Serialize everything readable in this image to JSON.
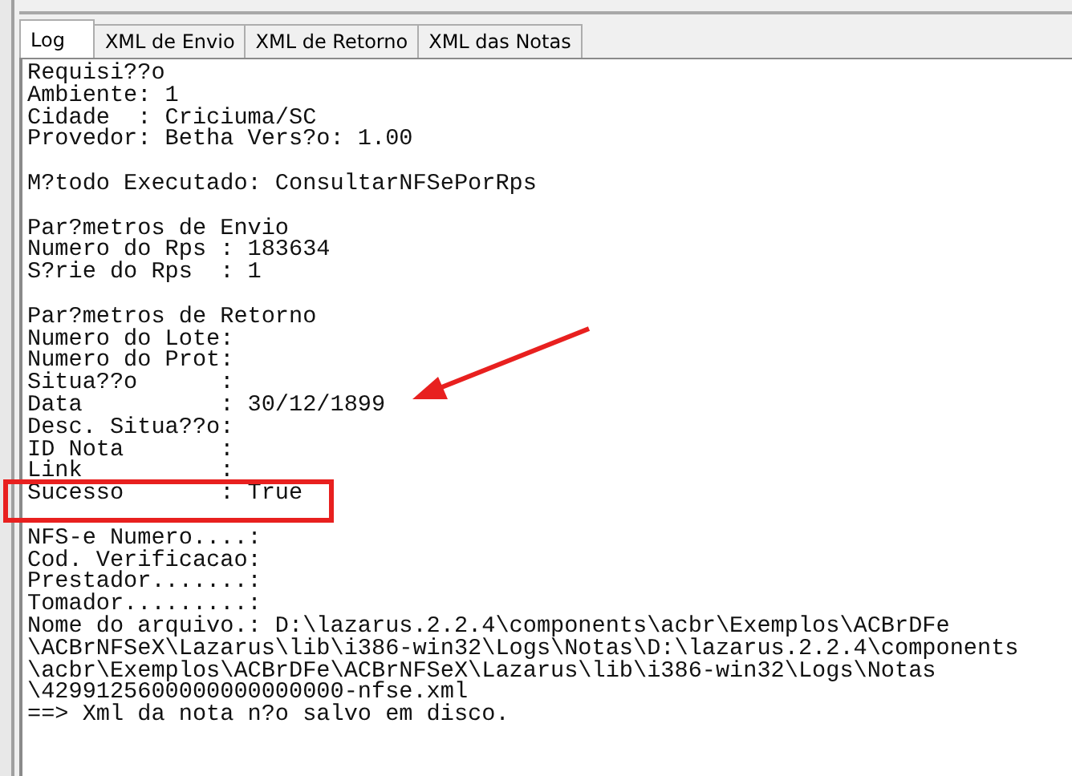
{
  "tabs": [
    {
      "label": "Log",
      "selected": true
    },
    {
      "label": "XML de Envio",
      "selected": false
    },
    {
      "label": "XML de Retorno",
      "selected": false
    },
    {
      "label": "XML das Notas",
      "selected": false
    }
  ],
  "log": {
    "blocks": [
      {
        "lines": [
          "Requisi??o",
          "Ambiente: 1",
          "Cidade  : Criciuma/SC",
          "Provedor: Betha Vers?o: 1.00"
        ]
      },
      {
        "lines": [
          "M?todo Executado: ConsultarNFSePorRps"
        ]
      },
      {
        "lines": [
          "Par?metros de Envio",
          "Numero do Rps : 183634",
          "S?rie do Rps  : 1"
        ]
      },
      {
        "lines": [
          "Par?metros de Retorno",
          "Numero do Lote:",
          "Numero do Prot:",
          "Situa??o      :",
          "Data          : 30/12/1899",
          "Desc. Situa??o:",
          "ID Nota       :",
          "Link          :",
          "Sucesso       : True"
        ]
      },
      {
        "lines": [
          "NFS-e Numero....:",
          "Cod. Verificacao:",
          "Prestador.......:",
          "Tomador.........:",
          "Nome do arquivo.: D:\\lazarus.2.2.4\\components\\acbr\\Exemplos\\ACBrDFe",
          "\\ACBrNFSeX\\Lazarus\\lib\\i386-win32\\Logs\\Notas\\D:\\lazarus.2.2.4\\components",
          "\\acbr\\Exemplos\\ACBrDFe\\ACBrNFSeX\\Lazarus\\lib\\i386-win32\\Logs\\Notas",
          "\\4299125600000000000000-nfse.xml",
          "==> Xml da nota n?o salvo em disco."
        ]
      }
    ]
  },
  "arrow_annotation": true,
  "highlight_annotation": true
}
